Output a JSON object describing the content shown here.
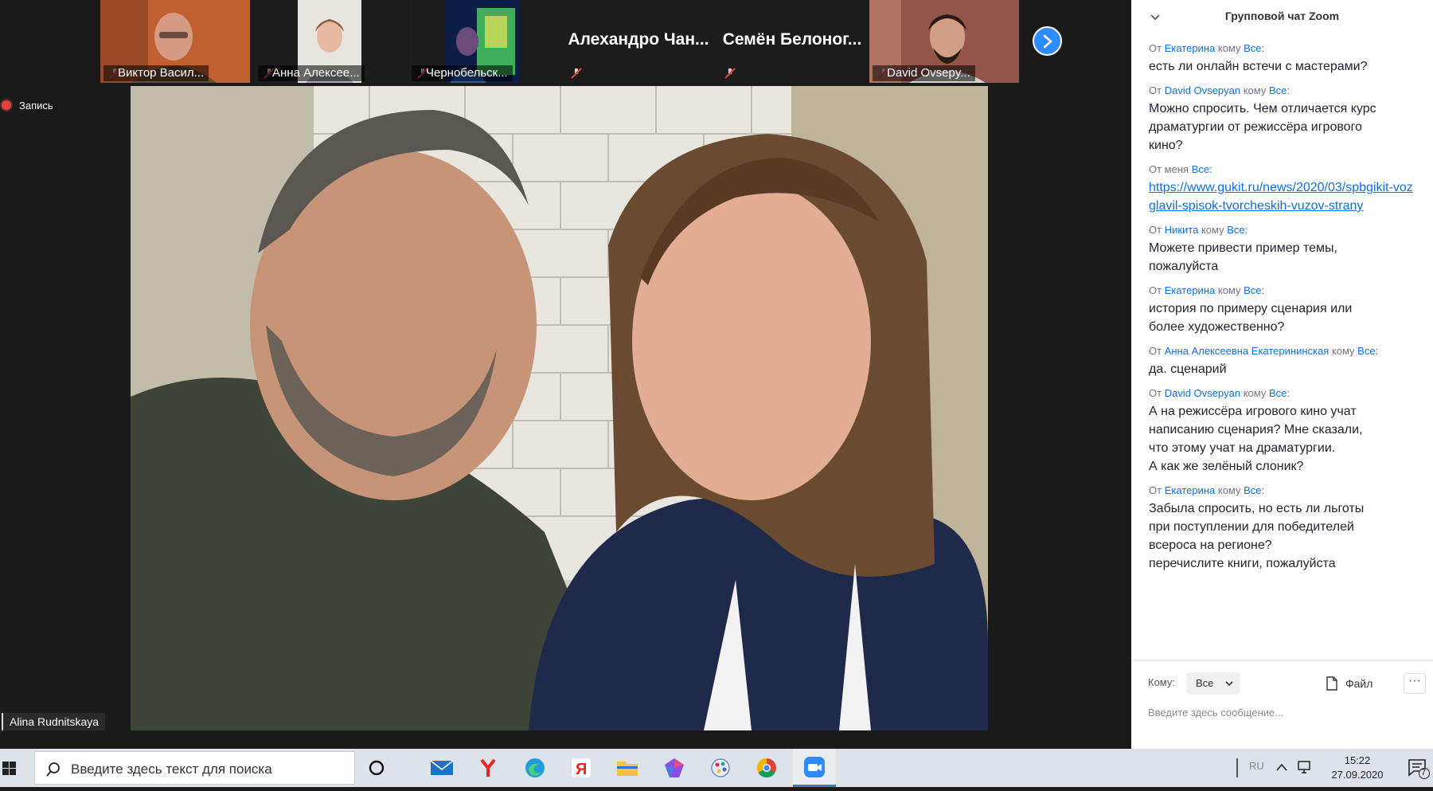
{
  "participants": [
    {
      "name": "Виктор Васил...",
      "muted": true
    },
    {
      "name": "Анна Алексее...",
      "muted": true
    },
    {
      "name": "Чернобельск...",
      "muted": true
    },
    {
      "name": "Алехандро Чан...",
      "muted": true
    },
    {
      "name": "Семён Белоног...",
      "muted": true
    },
    {
      "name": "David Ovsepy...",
      "muted": true
    }
  ],
  "recording": {
    "label": "Запись"
  },
  "active_speaker": {
    "name": "Alina Rudnitskaya"
  },
  "chat": {
    "title": "Групповой чат Zoom",
    "messages": [
      {
        "from_prefix": "От",
        "from": "Екатерина",
        "to_word": "кому",
        "to": "Все:",
        "lines": [
          "есть ли онлайн встечи с  мастерами?"
        ]
      },
      {
        "from_prefix": "От",
        "from": "David Ovsepyan",
        "to_word": "кому",
        "to": "Все:",
        "lines": [
          "Можно спросить. Чем отличается курс",
          "драматургии от режиссёра игрового",
          "кино?"
        ]
      },
      {
        "from_prefix": "От меня",
        "from": "",
        "to_word": "",
        "to": "Все:",
        "link": "https://www.gukit.ru/news/2020/03/spbgikit-vozglavil-spisok-tvorcheskih-vuzov-strany"
      },
      {
        "from_prefix": "От",
        "from": "Никита",
        "to_word": "кому",
        "to": "Все:",
        "lines": [
          "Можете привести пример темы,",
          "пожалуйста"
        ]
      },
      {
        "from_prefix": "От",
        "from": "Екатерина",
        "to_word": "кому",
        "to": "Все:",
        "lines": [
          "история по примеру сценария или",
          "более художественно?"
        ]
      },
      {
        "from_prefix": "От",
        "from": "Анна Алексеевна Екатерининская",
        "to_word": "кому",
        "to": "Все:",
        "lines": [
          "да. сценарий"
        ]
      },
      {
        "from_prefix": "От",
        "from": "David Ovsepyan",
        "to_word": "кому",
        "to": "Все:",
        "lines": [
          "А на режиссёра игрового кино учат",
          "написанию сценария? Мне сказали,",
          "что этому учат на драматургии.",
          "А как же зелёный слоник?"
        ]
      },
      {
        "from_prefix": "От",
        "from": "Екатерина",
        "to_word": "кому",
        "to": "Все:",
        "lines": [
          "Забыла спросить, но есть ли льготы",
          "при поступлении для победителей",
          "всероса на регионе?",
          "перечислите книги, пожалуйста"
        ]
      }
    ],
    "compose": {
      "to_label": "Кому:",
      "to_value": "Все",
      "file_label": "Файл",
      "more_label": "···",
      "placeholder": "Введите здесь сообщение..."
    }
  },
  "taskbar": {
    "search_placeholder": "Введите здесь текст для поиска",
    "apps": [
      "task-view",
      "mail",
      "yandex-browser",
      "edge",
      "yandex",
      "file-explorer",
      "app-gem",
      "app-paint",
      "chrome",
      "zoom"
    ],
    "active_app": "zoom",
    "language": "RU",
    "time": "15:22",
    "date": "27.09.2020",
    "notifications": "7"
  },
  "colors": {
    "accent": "#2d8cff",
    "link": "#0e71eb",
    "mute": "#e0433b"
  }
}
